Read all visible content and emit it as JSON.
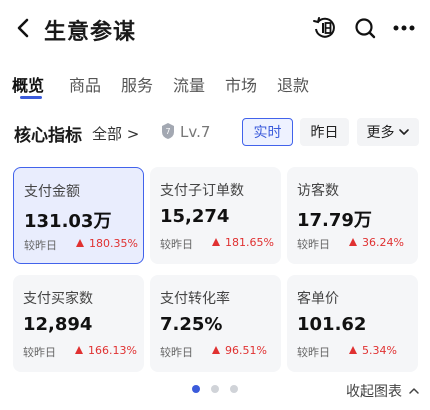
{
  "header": {
    "title": "生意参谋",
    "back_icon": "chevron-left-icon",
    "icons": [
      "history-icon",
      "search-icon",
      "more-icon"
    ]
  },
  "tabs": [
    {
      "label": "概览",
      "active": true
    },
    {
      "label": "商品"
    },
    {
      "label": "服务"
    },
    {
      "label": "流量"
    },
    {
      "label": "市场"
    },
    {
      "label": "退款"
    }
  ],
  "filter": {
    "title": "核心指标",
    "scope": "全部 >",
    "level": "Lv.7",
    "chips": {
      "realtime": "实时",
      "yesterday": "昨日",
      "more": "更多"
    }
  },
  "metrics": [
    {
      "label": "支付金额",
      "value": "131.03万",
      "compare_label": "较昨日",
      "change": "180.35%"
    },
    {
      "label": "支付子订单数",
      "value": "15,274",
      "compare_label": "较昨日",
      "change": "181.65%"
    },
    {
      "label": "访客数",
      "value": "17.79万",
      "compare_label": "较昨日",
      "change": "36.24%"
    },
    {
      "label": "支付买家数",
      "value": "12,894",
      "compare_label": "较昨日",
      "change": "166.13%"
    },
    {
      "label": "支付转化率",
      "value": "7.25%",
      "compare_label": "较昨日",
      "change": "96.51%"
    },
    {
      "label": "客单价",
      "value": "101.62",
      "compare_label": "较昨日",
      "change": "5.34%"
    }
  ],
  "pager": {
    "pages": 3,
    "current": 1
  },
  "footer": {
    "collapse_label": "收起图表"
  },
  "colors": {
    "accent": "#3b5bdb",
    "up": "#e03131"
  }
}
